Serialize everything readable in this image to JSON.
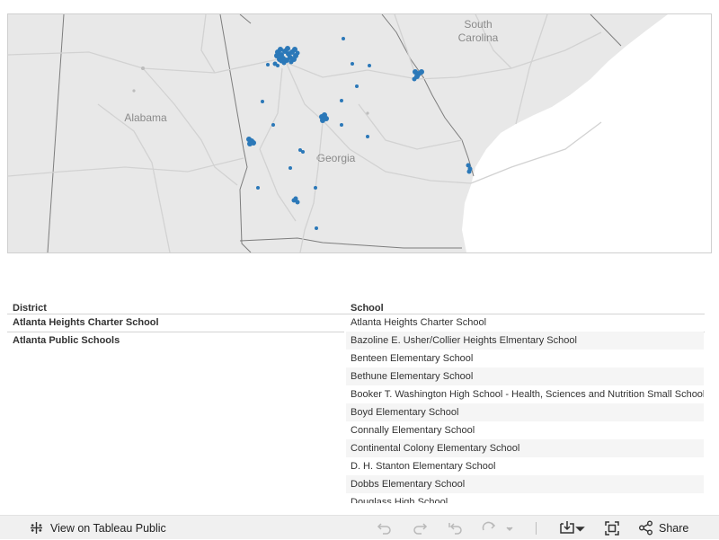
{
  "map": {
    "labels": {
      "south_carolina_1": "South",
      "south_carolina_2": "Carolina",
      "alabama": "Alabama",
      "georgia": "Georgia"
    },
    "point_color": "#1f77b4",
    "land_color": "#e8e8e8",
    "ocean_color": "#ffffff"
  },
  "table": {
    "headers": {
      "district": "District",
      "school": "School"
    },
    "districts": [
      {
        "name": "Atlanta Heights Charter School"
      },
      {
        "name": "Atlanta Public Schools"
      }
    ],
    "schools": [
      "Atlanta Heights Charter School",
      "Bazoline E. Usher/Collier Heights Elmentary School",
      "Benteen Elementary School",
      "Bethune Elementary School",
      "Booker T. Washington High School - Health, Sciences and Nutrition Small School",
      "Boyd Elementary School",
      "Connally Elementary School",
      "Continental Colony Elementary School",
      "D. H. Stanton Elementary School",
      "Dobbs Elementary School",
      "Douglass High School"
    ]
  },
  "toolbar": {
    "view_label": "View on Tableau Public",
    "share_label": "Share",
    "icons": {
      "view": "tableau-logo-icon",
      "undo": "undo-icon",
      "redo": "redo-icon",
      "revert": "revert-icon",
      "refresh": "refresh-icon",
      "download": "download-icon",
      "fullscreen": "fullscreen-icon",
      "share": "share-icon"
    }
  }
}
